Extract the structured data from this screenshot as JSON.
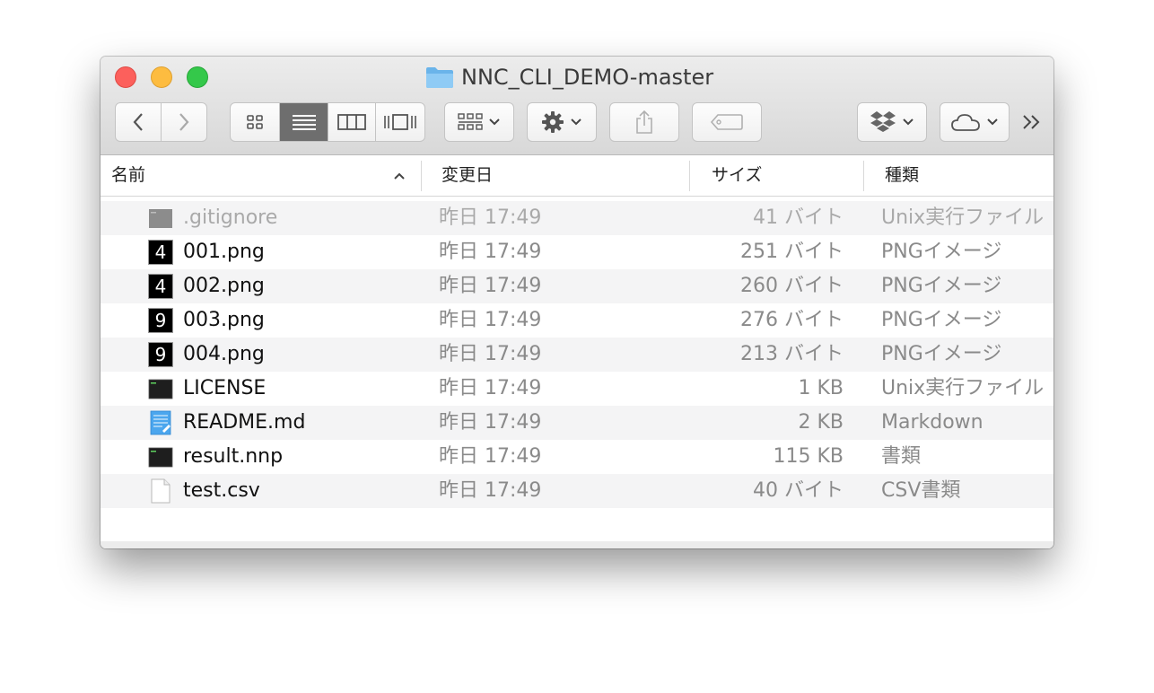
{
  "window": {
    "title": "NNC_CLI_DEMO-master",
    "folder_icon": "folder-icon",
    "colors": {
      "close": "#fc605c",
      "minimize": "#fdbc40",
      "zoom": "#34c84a"
    }
  },
  "toolbar": {
    "back_icon": "chevron-left-icon",
    "forward_icon": "chevron-right-icon",
    "view_modes": [
      "icon-view",
      "list-view",
      "column-view",
      "cover-flow-view"
    ],
    "active_view": "list-view",
    "arrange_icon": "group-arrange-icon",
    "action_icon": "gear-icon",
    "share_icon": "share-icon",
    "tag_icon": "tag-icon",
    "dropbox_icon": "dropbox-icon",
    "cloud_icon": "cloud-icon",
    "overflow": "»"
  },
  "columns": {
    "name": "名前",
    "date": "変更日",
    "size": "サイズ",
    "kind": "種類"
  },
  "files": [
    {
      "name": ".gitignore",
      "date": "昨日 17:49",
      "size": "41 バイト",
      "kind": "Unix実行ファイル",
      "icon": "unix-executable-icon"
    },
    {
      "name": "001.png",
      "date": "昨日 17:49",
      "size": "251 バイト",
      "kind": "PNGイメージ",
      "icon": "png-thumbnail-icon",
      "glyph": "4"
    },
    {
      "name": "002.png",
      "date": "昨日 17:49",
      "size": "260 バイト",
      "kind": "PNGイメージ",
      "icon": "png-thumbnail-icon",
      "glyph": "4"
    },
    {
      "name": "003.png",
      "date": "昨日 17:49",
      "size": "276 バイト",
      "kind": "PNGイメージ",
      "icon": "png-thumbnail-icon",
      "glyph": "9"
    },
    {
      "name": "004.png",
      "date": "昨日 17:49",
      "size": "213 バイト",
      "kind": "PNGイメージ",
      "icon": "png-thumbnail-icon",
      "glyph": "9"
    },
    {
      "name": "LICENSE",
      "date": "昨日 17:49",
      "size": "1 KB",
      "kind": "Unix実行ファイル",
      "icon": "unix-executable-icon"
    },
    {
      "name": "README.md",
      "date": "昨日 17:49",
      "size": "2 KB",
      "kind": "Markdown",
      "icon": "markdown-document-icon"
    },
    {
      "name": "result.nnp",
      "date": "昨日 17:49",
      "size": "115 KB",
      "kind": "書類",
      "icon": "unix-executable-icon"
    },
    {
      "name": "test.csv",
      "date": "昨日 17:49",
      "size": "40 バイト",
      "kind": "CSV書類",
      "icon": "blank-document-icon"
    }
  ]
}
